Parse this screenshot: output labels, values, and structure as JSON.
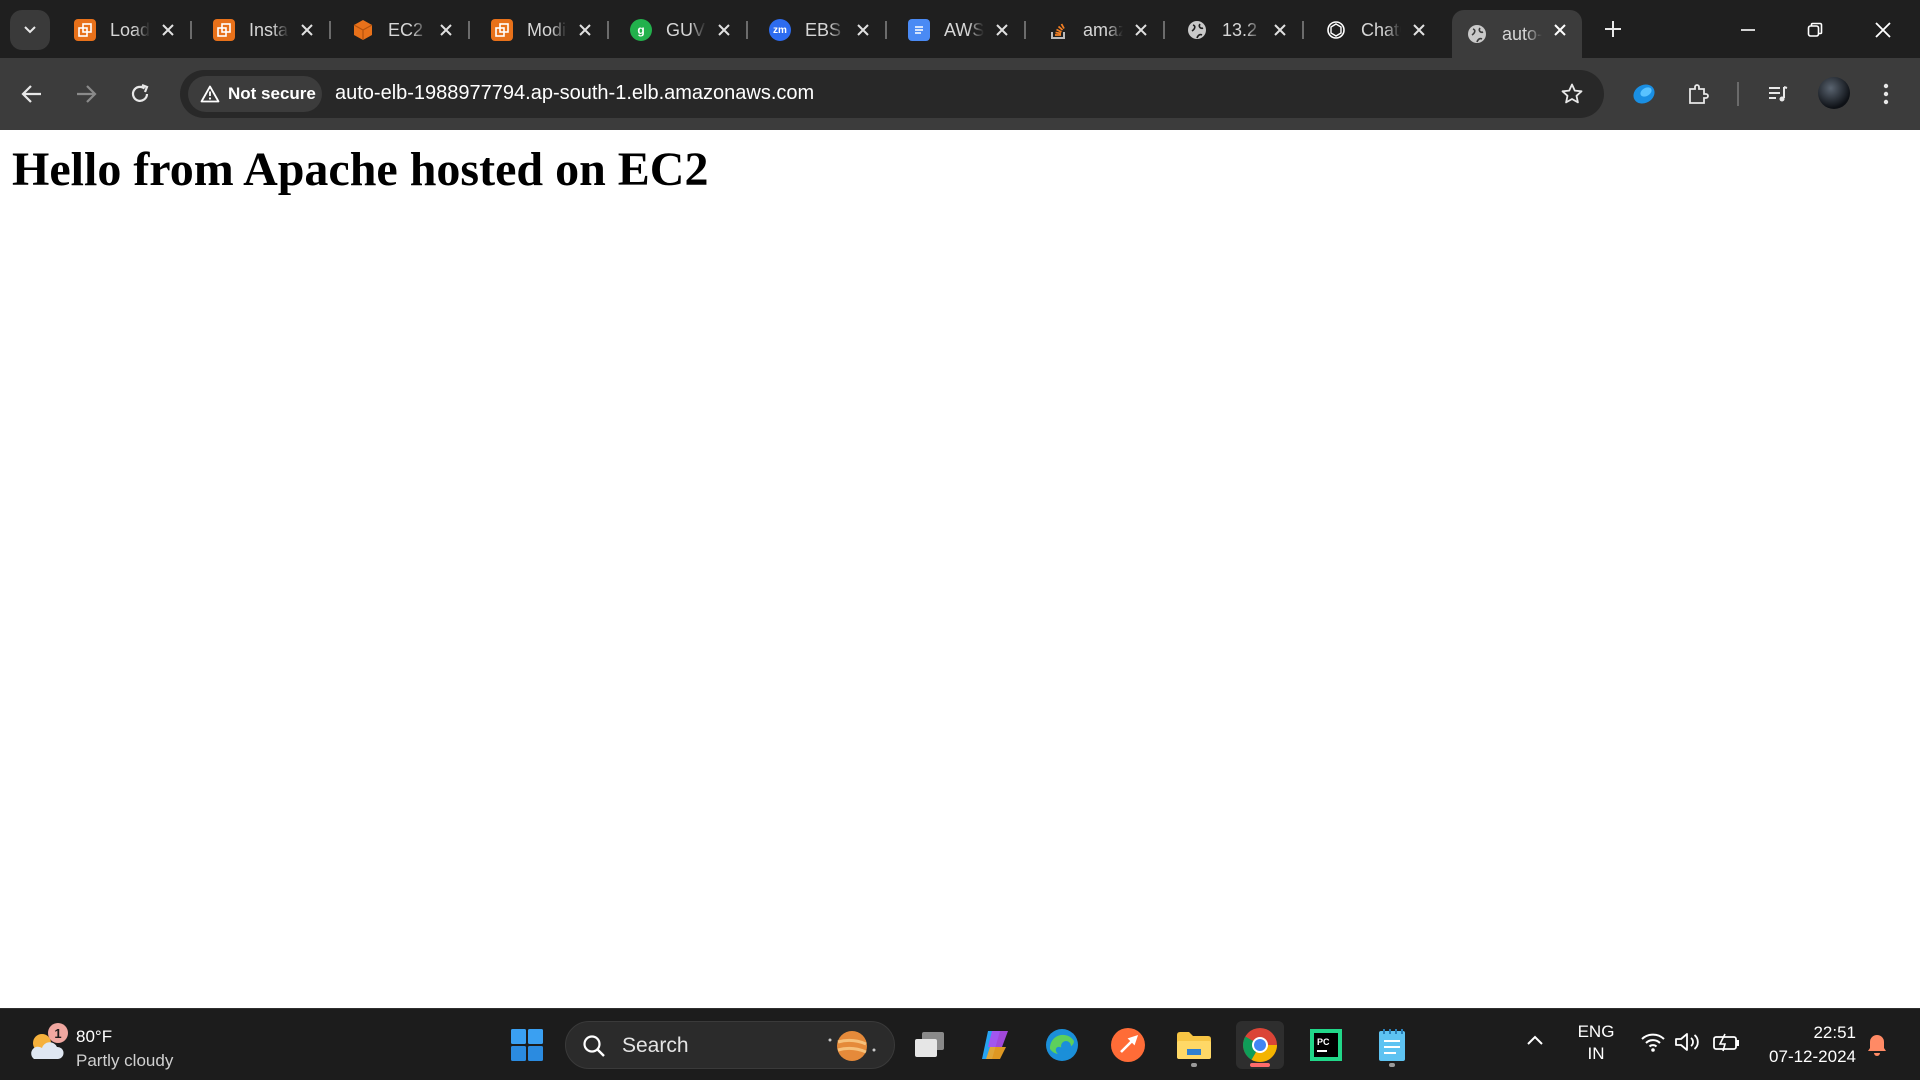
{
  "browser": {
    "tabs": [
      {
        "title": "Load Balancers",
        "icon": "aws-console-icon",
        "color": "#e8711a"
      },
      {
        "title": "Instances",
        "icon": "aws-console-icon",
        "color": "#e8711a"
      },
      {
        "title": "EC2",
        "icon": "ec2-cube-icon",
        "color": "#e8711a"
      },
      {
        "title": "Modify",
        "icon": "aws-console-icon",
        "color": "#e8711a"
      },
      {
        "title": "GUVI",
        "icon": "guvi-icon",
        "color": "#22b14c"
      },
      {
        "title": "EBS",
        "icon": "zoom-icon",
        "color": "#2d6cf0"
      },
      {
        "title": "AWS",
        "icon": "google-docs-icon",
        "color": "#4a8af4"
      },
      {
        "title": "amazon",
        "icon": "stackoverflow-icon",
        "color": "#f48024"
      },
      {
        "title": "13.2",
        "icon": "globe-icon",
        "color": "#c9c9c9"
      },
      {
        "title": "ChatGPT",
        "icon": "chatgpt-icon",
        "color": "#ffffff"
      },
      {
        "title": "auto-elb",
        "icon": "globe-icon",
        "color": "#c9c9c9",
        "active": true
      }
    ],
    "security_label": "Not secure",
    "url": "auto-elb-1988977794.ap-south-1.elb.amazonaws.com"
  },
  "page": {
    "heading": "Hello from Apache hosted on EC2"
  },
  "taskbar": {
    "weather": {
      "temp": "80°F",
      "desc": "Partly cloudy",
      "badge": "1"
    },
    "search_label": "Search",
    "apps": [
      "windows-start-icon",
      "task-view-icon",
      "copilot-icon",
      "edge-icon",
      "postman-icon",
      "file-explorer-icon",
      "chrome-icon",
      "pycharm-icon",
      "notepad-icon"
    ],
    "lang_line1": "ENG",
    "lang_line2": "IN",
    "time": "22:51",
    "date": "07-12-2024"
  },
  "colors": {
    "tabstrip": "#1f1f1f",
    "toolbar": "#3c3c3c",
    "omnibox": "#282828",
    "taskbar": "#1c1c1c"
  }
}
